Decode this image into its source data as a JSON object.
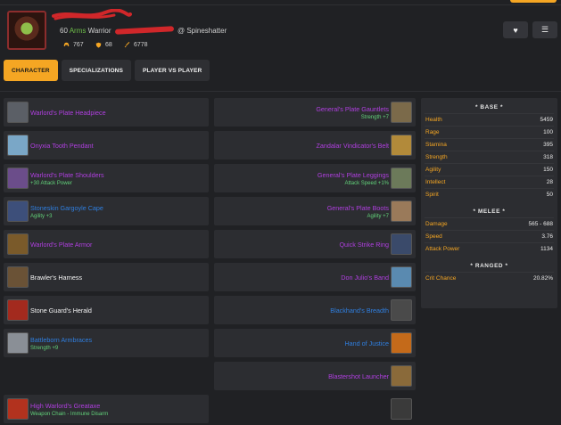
{
  "character": {
    "level": "60",
    "spec": "Arms",
    "class": "Warrior",
    "realm": "@ Spineshatter",
    "stats": [
      {
        "icon": "helmet-icon",
        "value": "767"
      },
      {
        "icon": "shield-icon",
        "value": "68"
      },
      {
        "icon": "sword-icon",
        "value": "6778"
      }
    ]
  },
  "actions": {
    "favorite_icon": "heart-icon",
    "menu_icon": "menu-icon"
  },
  "tabs": [
    {
      "label": "CHARACTER",
      "active": true
    },
    {
      "label": "SPECIALIZATIONS",
      "active": false
    },
    {
      "label": "PLAYER VS PLAYER",
      "active": false
    }
  ],
  "gear_left": [
    {
      "name": "Warlord's Plate Headpiece",
      "quality": "epic",
      "sub": "",
      "icon_color": "#5b5f66"
    },
    {
      "name": "Onyxia Tooth Pendant",
      "quality": "epic",
      "sub": "",
      "icon_color": "#7aa7c7"
    },
    {
      "name": "Warlord's Plate Shoulders",
      "quality": "epic",
      "sub": "+30 Attack Power",
      "icon_color": "#6b4d8a"
    },
    {
      "name": "Stoneskin Gargoyle Cape",
      "quality": "rare",
      "sub": "Agility +3",
      "icon_color": "#3d4f7a"
    },
    {
      "name": "Warlord's Plate Armor",
      "quality": "epic",
      "sub": "",
      "icon_color": "#7a5a2a"
    },
    {
      "name": "Brawler's Harness",
      "quality": "common",
      "sub": "",
      "icon_color": "#6a5236"
    },
    {
      "name": "Stone Guard's Herald",
      "quality": "common",
      "sub": "",
      "icon_color": "#a32a1e"
    },
    {
      "name": "Battleborn Armbraces",
      "quality": "rare",
      "sub": "Strength +9",
      "icon_color": "#8a8f96"
    },
    {
      "name": "",
      "quality": "empty",
      "sub": "",
      "icon_color": ""
    },
    {
      "name": "High Warlord's Greataxe",
      "quality": "epic",
      "sub": "Weapon Chain - Immune Disarm",
      "icon_color": "#b2321e"
    }
  ],
  "gear_right": [
    {
      "name": "General's Plate Gauntlets",
      "quality": "epic",
      "sub": "Strength +7",
      "icon_color": "#7b6a4a"
    },
    {
      "name": "Zandalar Vindicator's Belt",
      "quality": "epic",
      "sub": "",
      "icon_color": "#b28a3a"
    },
    {
      "name": "General's Plate Leggings",
      "quality": "epic",
      "sub": "Attack Speed +1%",
      "icon_color": "#6c7a5a"
    },
    {
      "name": "General's Plate Boots",
      "quality": "epic",
      "sub": "Agility +7",
      "icon_color": "#9a7a5a"
    },
    {
      "name": "Quick Strike Ring",
      "quality": "epic",
      "sub": "",
      "icon_color": "#3a4a6a"
    },
    {
      "name": "Don Julio's Band",
      "quality": "epic",
      "sub": "",
      "icon_color": "#5a8ab0"
    },
    {
      "name": "Blackhand's Breadth",
      "quality": "rare",
      "sub": "",
      "icon_color": "#4a4a4a"
    },
    {
      "name": "Hand of Justice",
      "quality": "rare",
      "sub": "",
      "icon_color": "#c46a1a"
    },
    {
      "name": "Blastershot Launcher",
      "quality": "epic",
      "sub": "",
      "icon_color": "#8a6a3a"
    },
    {
      "name": "",
      "quality": "empty-icon",
      "sub": "",
      "icon_color": "#3a3a3a"
    }
  ],
  "sidebar": {
    "sections": [
      {
        "title": "* BASE *",
        "rows": [
          {
            "label": "Health",
            "value": "5459"
          },
          {
            "label": "Rage",
            "value": "100"
          },
          {
            "label": "Stamina",
            "value": "395"
          },
          {
            "label": "Strength",
            "value": "318"
          },
          {
            "label": "Agility",
            "value": "150"
          },
          {
            "label": "Intellect",
            "value": "28"
          },
          {
            "label": "Spirit",
            "value": "50"
          }
        ]
      },
      {
        "title": "* MELEE *",
        "rows": [
          {
            "label": "Damage",
            "value": "565 - 688"
          },
          {
            "label": "Speed",
            "value": "3.76"
          },
          {
            "label": "Attack Power",
            "value": "1134"
          }
        ]
      },
      {
        "title": "* RANGED *",
        "rows": [
          {
            "label": "Crit Chance",
            "value": "20.82%"
          }
        ]
      }
    ]
  }
}
